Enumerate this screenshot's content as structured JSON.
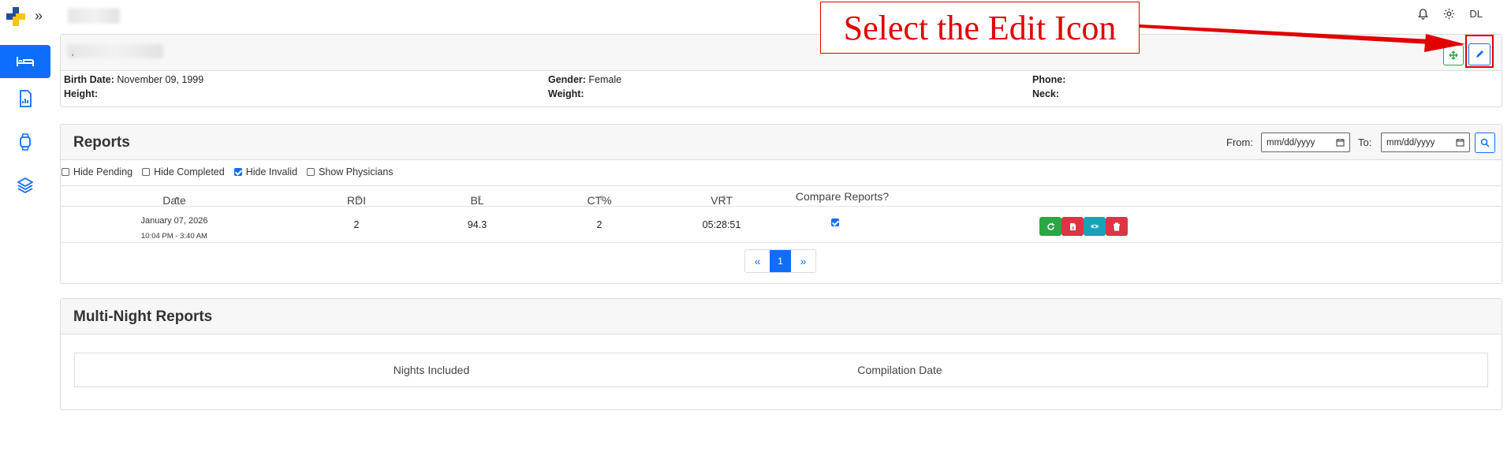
{
  "topbar": {
    "user_initials": "DL",
    "bell_icon": "bell-icon",
    "settings_icon": "gear-icon"
  },
  "sidebar": {
    "expand_label": "»",
    "items": [
      {
        "name": "bed-icon",
        "active": true
      },
      {
        "name": "report-icon",
        "active": false
      },
      {
        "name": "watch-icon",
        "active": false
      },
      {
        "name": "layers-icon",
        "active": false
      }
    ]
  },
  "patient": {
    "name_suffix": "'",
    "birth_date_label": "Birth Date:",
    "birth_date": "November 09, 1999",
    "gender_label": "Gender:",
    "gender": "Female",
    "phone_label": "Phone:",
    "height_label": "Height:",
    "weight_label": "Weight:",
    "neck_label": "Neck:"
  },
  "reports": {
    "title": "Reports",
    "from_label": "From:",
    "to_label": "To:",
    "from_placeholder": "mm/dd/yyyy",
    "to_placeholder": "mm/dd/yyyy",
    "filters": [
      {
        "label": "Hide Pending",
        "checked": false
      },
      {
        "label": "Hide Completed",
        "checked": false
      },
      {
        "label": "Hide Invalid",
        "checked": true
      },
      {
        "label": "Show Physicians",
        "checked": false
      }
    ],
    "columns": [
      "Date",
      "RDI",
      "BL",
      "CT%",
      "VRT",
      "Compare Reports?"
    ],
    "rows": [
      {
        "date": "January 07, 2026",
        "time": "10:04 PM - 3:40 AM",
        "rdi": "2",
        "bl": "94.3",
        "ct": "2",
        "vrt": "05:28:51",
        "compare": true
      }
    ],
    "actions": [
      {
        "name": "refresh-icon",
        "color": "#28a745"
      },
      {
        "name": "pdf-icon",
        "color": "#dc3545"
      },
      {
        "name": "view-icon",
        "color": "#17a2b8"
      },
      {
        "name": "trash-icon",
        "color": "#dc3545"
      }
    ],
    "pager": {
      "prev": "«",
      "current": "1",
      "next": "»"
    }
  },
  "multi_night": {
    "title": "Multi-Night Reports",
    "columns": [
      "Nights Included",
      "Compilation Date"
    ]
  },
  "annotation": {
    "text": "Select the Edit Icon",
    "color": "#e00000"
  }
}
